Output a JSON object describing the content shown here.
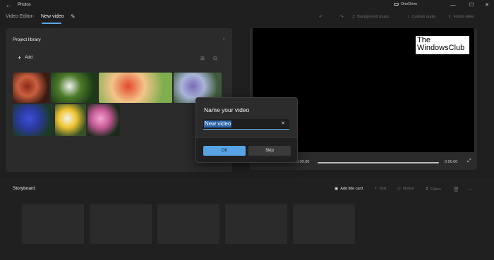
{
  "titlebar": {
    "app_title": "Photos",
    "onedrive_label": "OneDrive",
    "back_glyph": "←",
    "minimize_glyph": "—",
    "maximize_glyph": "☐",
    "close_glyph": "✕"
  },
  "toolbar": {
    "breadcrumb_parent": "Video Editor",
    "breadcrumb_separator": "›",
    "breadcrumb_current": "New video",
    "undo_glyph": "↶",
    "redo_glyph": "↷",
    "background_music": "Background music",
    "custom_audio": "Custom audio",
    "finish_video": "Finish video"
  },
  "library": {
    "title": "Project library",
    "add_label": "Add",
    "thumbnails": [
      {
        "name": "rafflesia",
        "colors": [
          "#8a2a1c",
          "#c9603e",
          "#3a1a12"
        ]
      },
      {
        "name": "white-lotus",
        "colors": [
          "#f2f2ee",
          "#4c7a2a",
          "#1d3a16"
        ]
      },
      {
        "name": "tulips",
        "colors": [
          "#e34a2c",
          "#f3c48a",
          "#7fae4e"
        ]
      },
      {
        "name": "lavender",
        "colors": [
          "#7a6ab8",
          "#a9b5d8",
          "#3f5a3a"
        ]
      },
      {
        "name": "cornflower",
        "colors": [
          "#3b4fd6",
          "#2b3a9e",
          "#1c3a24"
        ]
      },
      {
        "name": "daisy",
        "colors": [
          "#f4f4f0",
          "#f0c531",
          "#36502a"
        ]
      },
      {
        "name": "pink-lotus",
        "colors": [
          "#f2a7cf",
          "#c75b97",
          "#1a2a1a"
        ]
      }
    ]
  },
  "preview": {
    "logo_line1": "The",
    "logo_line2": "WindowsClub",
    "time_current": "0:00.00",
    "time_total": "0:00.00",
    "progress": 0
  },
  "storyboard": {
    "title": "Storyboard",
    "add_title_card": "Add title card",
    "text": "Text",
    "motion": "Motion",
    "filters": "Filters"
  },
  "dialog": {
    "title": "Name your video",
    "input_value": "New video",
    "ok_label": "OK",
    "skip_label": "Skip"
  },
  "colors": {
    "accent": "#57a3e3",
    "background": "#1f1f1f",
    "panel": "#2b2b2b"
  }
}
